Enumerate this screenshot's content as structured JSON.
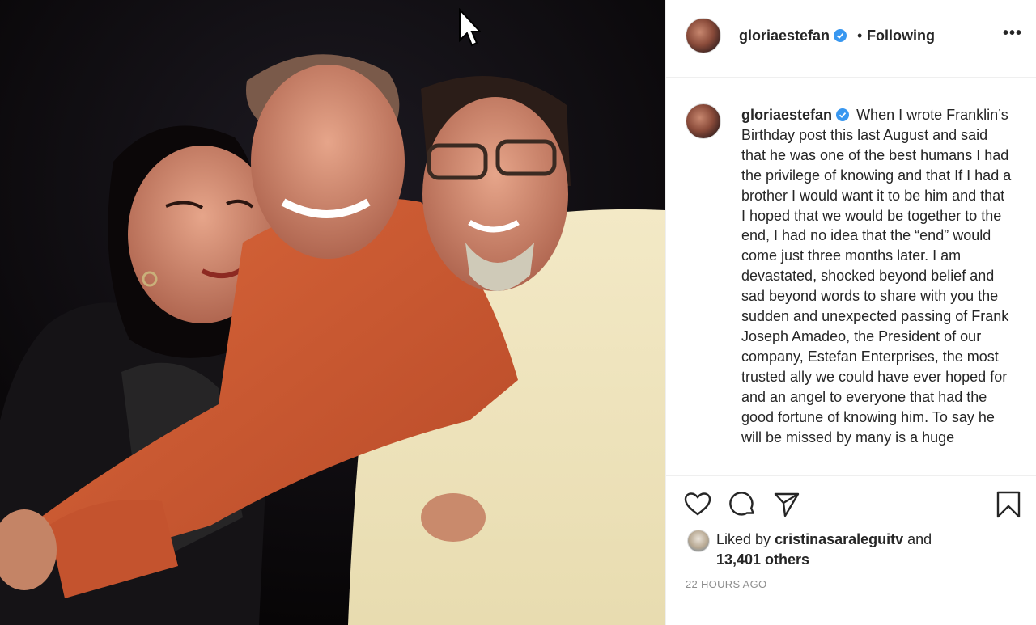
{
  "post": {
    "username": "gloriaestefan",
    "follow_status": "Following",
    "separator": "•",
    "more_label": "•••",
    "caption": "When I wrote Franklin’s Birthday post this last August and said that he was one of the best humans I had the privilege of knowing and that If I had a brother I would want it to be him and that I hoped that we would be together to the end, I had no idea that the “end” would come just three months later. I am devastated, shocked beyond belief and sad beyond words to share with you the sudden and unexpected passing of Frank Joseph Amadeo, the President of our company, Estefan Enterprises, the most trusted ally we could have ever hoped for and an angel to everyone that had the good fortune of knowing him. To say he will be missed by many is a huge",
    "liked_by_prefix": "Liked by",
    "liked_by_user": "cristinasaraleguitv",
    "liked_by_and": "and",
    "likes_others": "13,401 others",
    "timestamp": "22 HOURS AGO"
  },
  "icons": {
    "like": "heart-outline-icon",
    "comment": "speech-bubble-icon",
    "share": "paper-plane-icon",
    "save": "bookmark-icon",
    "verified": "verified-badge-icon",
    "cursor": "mouse-pointer-icon"
  },
  "colors": {
    "verified": "#3897f0",
    "text": "#262626",
    "muted": "#8e8e8e"
  }
}
